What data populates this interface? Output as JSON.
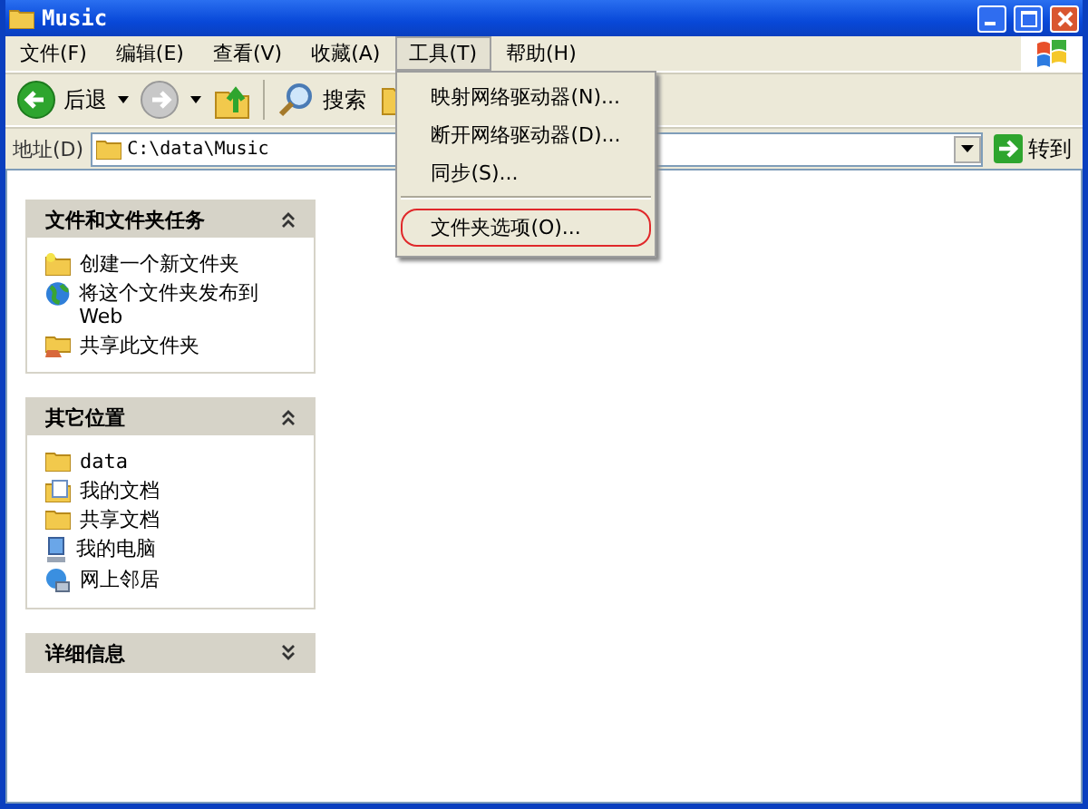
{
  "window": {
    "title": "Music"
  },
  "menu_bar": [
    {
      "label": "文件(F)",
      "open": false
    },
    {
      "label": "编辑(E)",
      "open": false
    },
    {
      "label": "查看(V)",
      "open": false
    },
    {
      "label": "收藏(A)",
      "open": false
    },
    {
      "label": "工具(T)",
      "open": true
    },
    {
      "label": "帮助(H)",
      "open": false
    }
  ],
  "dropdown": {
    "items": [
      {
        "label": "映射网络驱动器(N)...",
        "circled": false,
        "separator_before": false
      },
      {
        "label": "断开网络驱动器(D)...",
        "circled": false,
        "separator_before": false
      },
      {
        "label": "同步(S)...",
        "circled": false,
        "separator_before": false
      },
      {
        "label": "文件夹选项(O)...",
        "circled": true,
        "separator_before": true
      }
    ]
  },
  "toolbar": {
    "back": {
      "label": "后退",
      "disabled": false
    },
    "forward": {
      "disabled": true
    },
    "search": {
      "label": "搜索"
    }
  },
  "address_bar": {
    "label": "地址(D)",
    "value": "C:\\data\\Music",
    "go": "转到"
  },
  "panels": [
    {
      "title": "文件和文件夹任务",
      "expanded": true,
      "items": [
        {
          "label": "创建一个新文件夹",
          "kind": "new-folder"
        },
        {
          "label": "将这个文件夹发布到 Web",
          "kind": "globe"
        },
        {
          "label": "共享此文件夹",
          "kind": "shared-folder"
        }
      ]
    },
    {
      "title": "其它位置",
      "expanded": true,
      "items": [
        {
          "label": "data",
          "kind": "folder"
        },
        {
          "label": "我的文档",
          "kind": "document"
        },
        {
          "label": "共享文档",
          "kind": "folder"
        },
        {
          "label": "我的电脑",
          "kind": "computer"
        },
        {
          "label": "网上邻居",
          "kind": "network"
        }
      ]
    },
    {
      "title": "详细信息",
      "expanded": false
    }
  ]
}
